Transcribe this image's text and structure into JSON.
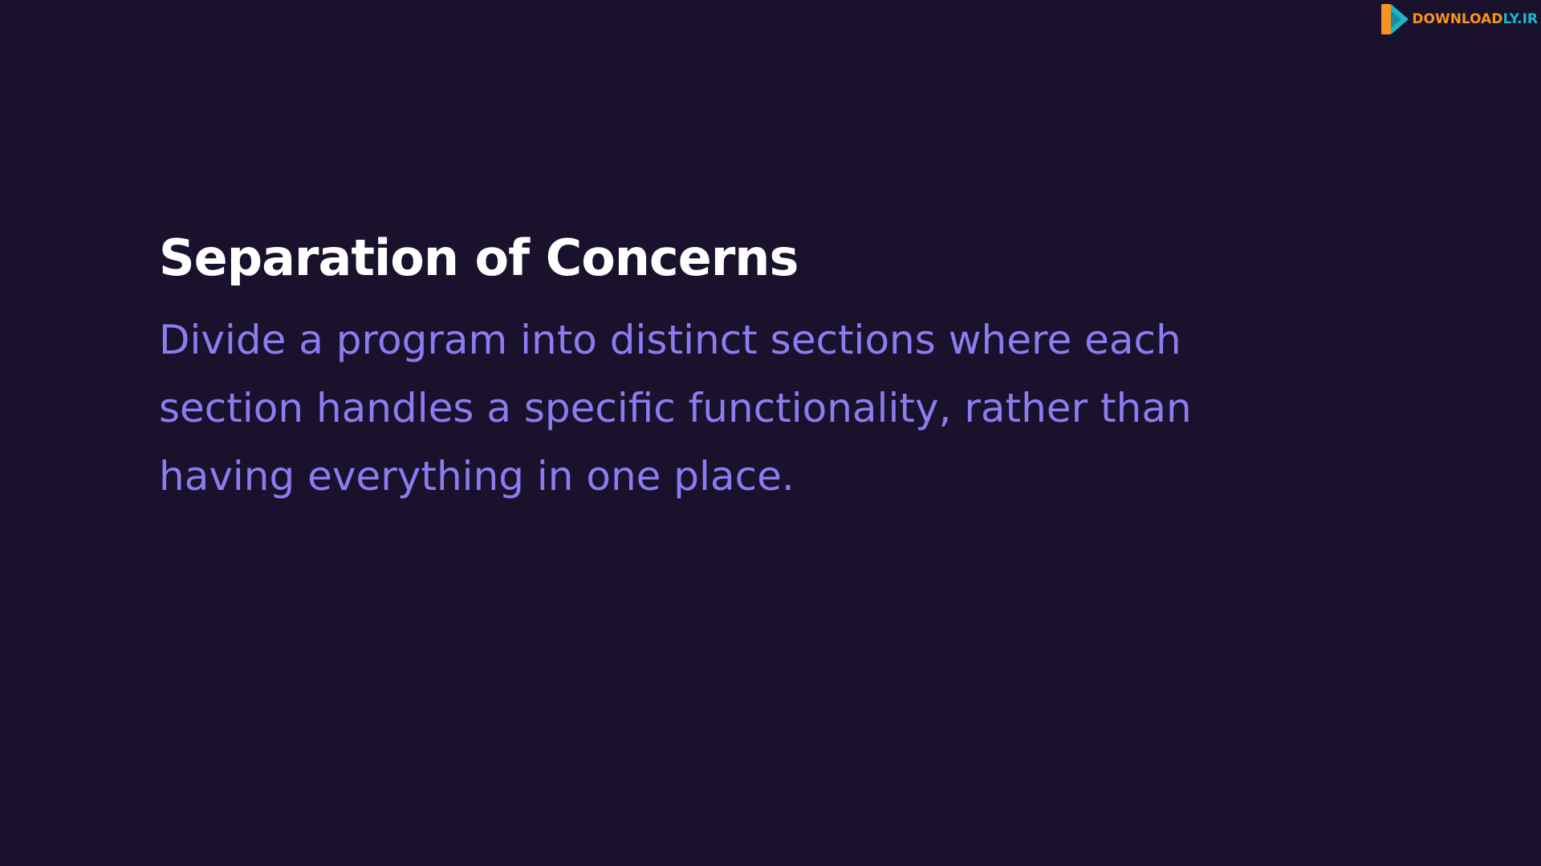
{
  "slide": {
    "title": "Separation of Concerns",
    "body": "Divide a program into distinct sections where each section handles a specific functionality, rather than having everything in one place."
  },
  "watermark": {
    "part_a": "DOWNLOAD",
    "part_b": "LY.IR",
    "icon": "play-logo-icon"
  },
  "colors": {
    "background": "#1a112c",
    "title": "#ffffff",
    "body": "#8c7cf0",
    "watermark_orange": "#f7931e",
    "watermark_teal": "#1fb5c9"
  }
}
